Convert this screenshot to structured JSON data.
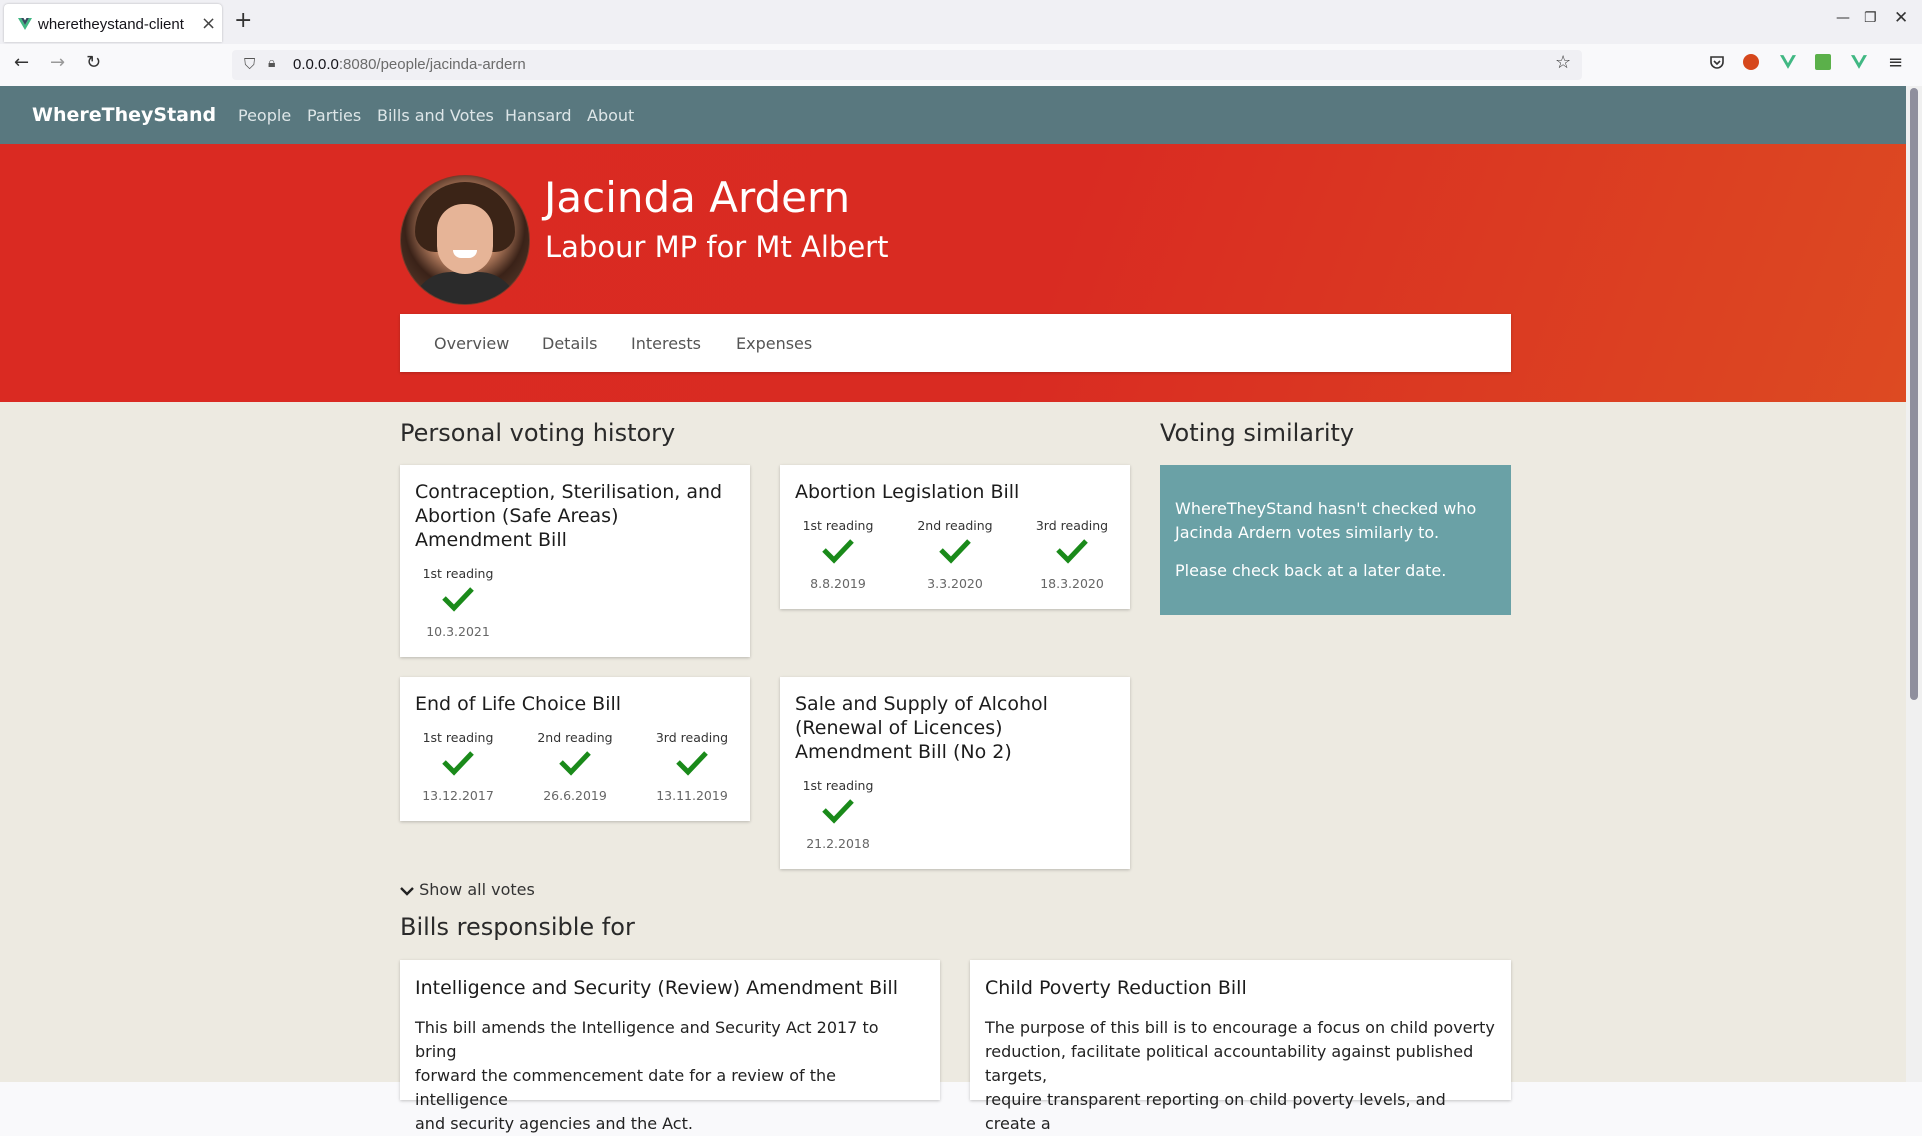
{
  "browser": {
    "tab_title": "wheretheystand-client",
    "url_host": "0.0.0.0",
    "url_rest": ":8080/people/jacinda-ardern"
  },
  "site": {
    "brand": "WhereTheyStand",
    "nav": [
      "People",
      "Parties",
      "Bills and Votes",
      "Hansard",
      "About"
    ]
  },
  "person": {
    "name": "Jacinda Ardern",
    "subtitle": "Labour MP for Mt Albert"
  },
  "profile_tabs": [
    "Overview",
    "Details",
    "Interests",
    "Expenses"
  ],
  "voting_history": {
    "heading": "Personal voting history",
    "bills": [
      {
        "title_lines": [
          "Contraception, Sterilisation, and",
          "Abortion (Safe Areas)",
          "Amendment Bill"
        ],
        "readings": [
          {
            "label": "1st reading",
            "vote": "aye",
            "date": "10.3.2021"
          }
        ]
      },
      {
        "title_lines": [
          "Abortion Legislation Bill"
        ],
        "readings": [
          {
            "label": "1st reading",
            "vote": "aye",
            "date": "8.8.2019"
          },
          {
            "label": "2nd reading",
            "vote": "aye",
            "date": "3.3.2020"
          },
          {
            "label": "3rd reading",
            "vote": "aye",
            "date": "18.3.2020"
          }
        ]
      },
      {
        "title_lines": [
          "End of Life Choice Bill"
        ],
        "readings": [
          {
            "label": "1st reading",
            "vote": "aye",
            "date": "13.12.2017"
          },
          {
            "label": "2nd reading",
            "vote": "aye",
            "date": "26.6.2019"
          },
          {
            "label": "3rd reading",
            "vote": "aye",
            "date": "13.11.2019"
          }
        ]
      },
      {
        "title_lines": [
          "Sale and Supply of Alcohol",
          "(Renewal of Licences)",
          "Amendment Bill (No 2)"
        ],
        "readings": [
          {
            "label": "1st reading",
            "vote": "aye",
            "date": "21.2.2018"
          }
        ]
      }
    ],
    "show_all_label": "Show all votes"
  },
  "similarity": {
    "heading": "Voting similarity",
    "message_lines": [
      "WhereTheyStand hasn't checked who",
      "Jacinda Ardern votes similarly to."
    ],
    "note": "Please check back at a later date."
  },
  "bills_responsible": {
    "heading": "Bills responsible for",
    "bills": [
      {
        "title": "Intelligence and Security (Review) Amendment Bill",
        "lines": [
          "This bill amends the Intelligence and Security Act 2017 to bring",
          "forward the commencement date for a review of the intelligence",
          "and security agencies and the Act."
        ]
      },
      {
        "title": "Child Poverty Reduction Bill",
        "lines": [
          "The purpose of this bill is to encourage a focus on child poverty",
          "reduction, facilitate political accountability against published targets,",
          "require transparent reporting on child poverty levels, and create a"
        ]
      }
    ]
  },
  "colors": {
    "header": "#59787f",
    "hero_red": "#da2a22",
    "check_green": "#1a8a1a",
    "similarity_card": "#6aa1a6"
  }
}
